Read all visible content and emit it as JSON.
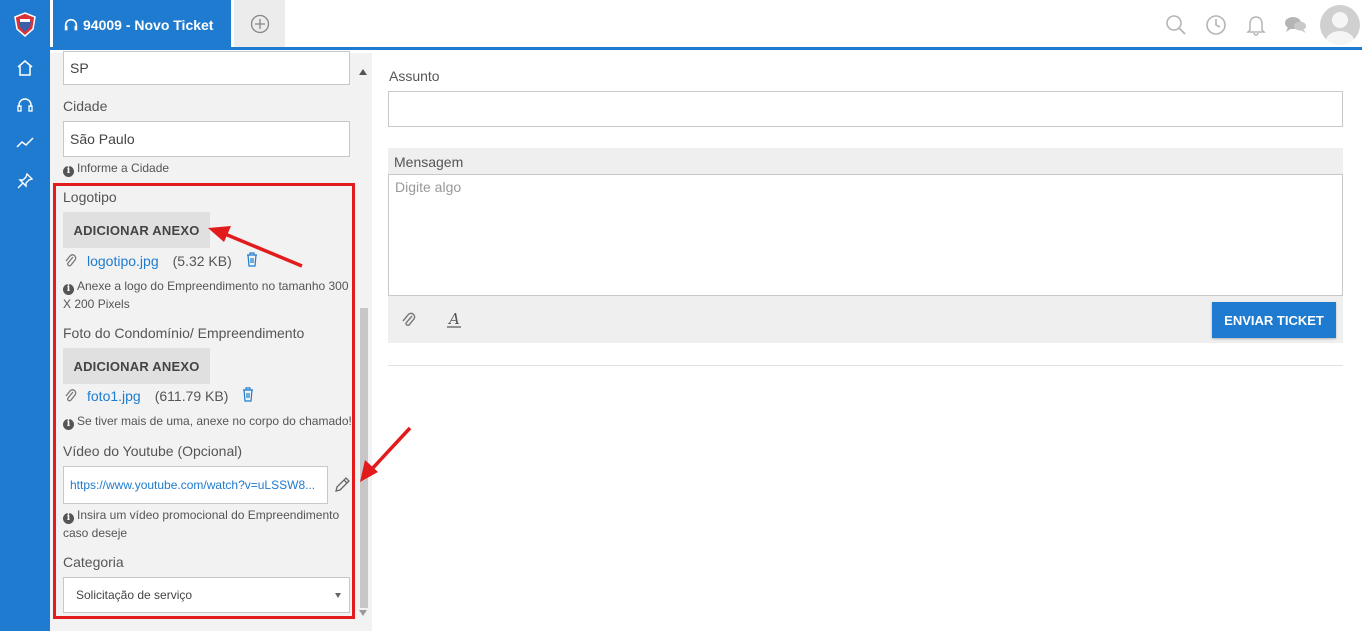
{
  "colors": {
    "accent": "#1e7bcf",
    "highlight": "#e21c1c"
  },
  "sidebar": {
    "icons": [
      "logo-icon",
      "home-icon",
      "headset-icon",
      "trend-chart-icon",
      "pin-icon"
    ]
  },
  "tabs": {
    "active_label": "94009 - Novo Ticket",
    "active_icon": "headset-icon",
    "add_icon": "plus-circle-icon"
  },
  "header_icons": [
    "search-icon",
    "clock-icon",
    "bell-icon",
    "chat-icon",
    "avatar"
  ],
  "form": {
    "estado_value": "SP",
    "cidade": {
      "label": "Cidade",
      "value": "São Paulo",
      "hint": "Informe a Cidade"
    },
    "logotipo": {
      "label": "Logotipo",
      "button": "ADICIONAR ANEXO",
      "file_name": "logotipo.jpg",
      "file_size": "(5.32 KB)",
      "hint": "Anexe a logo do Empreendimento no tamanho 300 X 200 Pixels"
    },
    "foto": {
      "label": "Foto do Condomínio/ Empreendimento",
      "button": "ADICIONAR ANEXO",
      "file_name": "foto1.jpg",
      "file_size": "(611.79 KB)",
      "hint": "Se tiver mais de uma, anexe no corpo do chamado!"
    },
    "video": {
      "label": "Vídeo do Youtube (Opcional)",
      "value": "https://www.youtube.com/watch?v=uLSSW8...",
      "hint": "Insira um vídeo promocional do Empreendimento caso deseje"
    },
    "categoria": {
      "label": "Categoria",
      "value": "Solicitação de serviço"
    }
  },
  "main": {
    "assunto_label": "Assunto",
    "assunto_value": "",
    "mensagem_label": "Mensagem",
    "mensagem_placeholder": "Digite algo",
    "send_button": "ENVIAR TICKET"
  }
}
